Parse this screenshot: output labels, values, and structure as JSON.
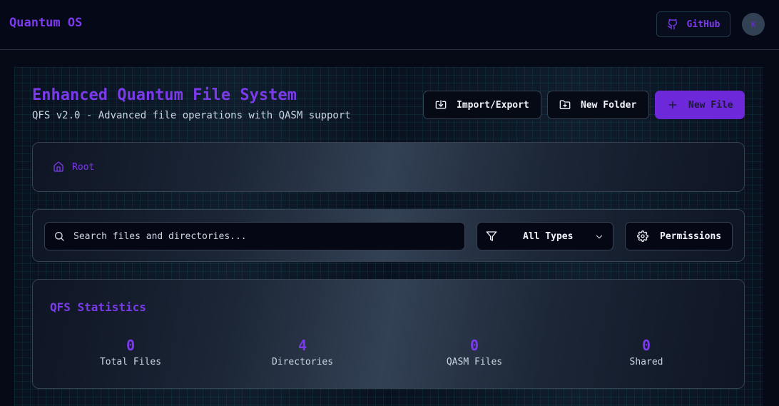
{
  "header": {
    "brand": "Quantum OS",
    "github_label": "GitHub",
    "avatar_initial": "K"
  },
  "page": {
    "title": "Enhanced Quantum File System",
    "subtitle": "QFS v2.0 - Advanced file operations with QASM support"
  },
  "actions": {
    "import_export": "Import/Export",
    "new_folder": "New Folder",
    "new_file": "New File"
  },
  "breadcrumb": {
    "root_label": "Root",
    "icon": "home-icon"
  },
  "search": {
    "placeholder": "Search files and directories...",
    "value": ""
  },
  "filter": {
    "selected": "All Types"
  },
  "permissions_label": "Permissions",
  "stats": {
    "title": "QFS Statistics",
    "items": [
      {
        "value": "0",
        "label": "Total Files"
      },
      {
        "value": "4",
        "label": "Directories"
      },
      {
        "value": "0",
        "label": "QASM Files"
      },
      {
        "value": "0",
        "label": "Shared"
      }
    ]
  },
  "colors": {
    "accent": "#7c3aed",
    "button_primary": "#6d28d9",
    "background": "#060a16"
  }
}
